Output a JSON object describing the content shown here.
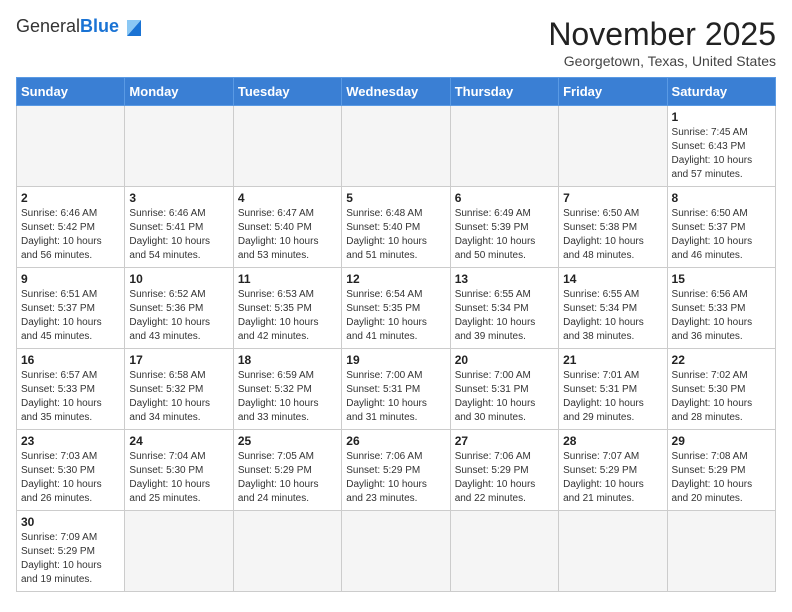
{
  "header": {
    "logo": {
      "line1": "General",
      "line2": "Blue"
    },
    "title": "November 2025",
    "location": "Georgetown, Texas, United States"
  },
  "calendar": {
    "weekdays": [
      "Sunday",
      "Monday",
      "Tuesday",
      "Wednesday",
      "Thursday",
      "Friday",
      "Saturday"
    ],
    "weeks": [
      [
        {
          "day": "",
          "sunrise": "",
          "sunset": "",
          "daylight": ""
        },
        {
          "day": "",
          "sunrise": "",
          "sunset": "",
          "daylight": ""
        },
        {
          "day": "",
          "sunrise": "",
          "sunset": "",
          "daylight": ""
        },
        {
          "day": "",
          "sunrise": "",
          "sunset": "",
          "daylight": ""
        },
        {
          "day": "",
          "sunrise": "",
          "sunset": "",
          "daylight": ""
        },
        {
          "day": "",
          "sunrise": "",
          "sunset": "",
          "daylight": ""
        },
        {
          "day": "1",
          "sunrise": "Sunrise: 7:45 AM",
          "sunset": "Sunset: 6:43 PM",
          "daylight": "Daylight: 10 hours and 57 minutes."
        }
      ],
      [
        {
          "day": "2",
          "sunrise": "Sunrise: 6:46 AM",
          "sunset": "Sunset: 5:42 PM",
          "daylight": "Daylight: 10 hours and 56 minutes."
        },
        {
          "day": "3",
          "sunrise": "Sunrise: 6:46 AM",
          "sunset": "Sunset: 5:41 PM",
          "daylight": "Daylight: 10 hours and 54 minutes."
        },
        {
          "day": "4",
          "sunrise": "Sunrise: 6:47 AM",
          "sunset": "Sunset: 5:40 PM",
          "daylight": "Daylight: 10 hours and 53 minutes."
        },
        {
          "day": "5",
          "sunrise": "Sunrise: 6:48 AM",
          "sunset": "Sunset: 5:40 PM",
          "daylight": "Daylight: 10 hours and 51 minutes."
        },
        {
          "day": "6",
          "sunrise": "Sunrise: 6:49 AM",
          "sunset": "Sunset: 5:39 PM",
          "daylight": "Daylight: 10 hours and 50 minutes."
        },
        {
          "day": "7",
          "sunrise": "Sunrise: 6:50 AM",
          "sunset": "Sunset: 5:38 PM",
          "daylight": "Daylight: 10 hours and 48 minutes."
        },
        {
          "day": "8",
          "sunrise": "Sunrise: 6:50 AM",
          "sunset": "Sunset: 5:37 PM",
          "daylight": "Daylight: 10 hours and 46 minutes."
        }
      ],
      [
        {
          "day": "9",
          "sunrise": "Sunrise: 6:51 AM",
          "sunset": "Sunset: 5:37 PM",
          "daylight": "Daylight: 10 hours and 45 minutes."
        },
        {
          "day": "10",
          "sunrise": "Sunrise: 6:52 AM",
          "sunset": "Sunset: 5:36 PM",
          "daylight": "Daylight: 10 hours and 43 minutes."
        },
        {
          "day": "11",
          "sunrise": "Sunrise: 6:53 AM",
          "sunset": "Sunset: 5:35 PM",
          "daylight": "Daylight: 10 hours and 42 minutes."
        },
        {
          "day": "12",
          "sunrise": "Sunrise: 6:54 AM",
          "sunset": "Sunset: 5:35 PM",
          "daylight": "Daylight: 10 hours and 41 minutes."
        },
        {
          "day": "13",
          "sunrise": "Sunrise: 6:55 AM",
          "sunset": "Sunset: 5:34 PM",
          "daylight": "Daylight: 10 hours and 39 minutes."
        },
        {
          "day": "14",
          "sunrise": "Sunrise: 6:55 AM",
          "sunset": "Sunset: 5:34 PM",
          "daylight": "Daylight: 10 hours and 38 minutes."
        },
        {
          "day": "15",
          "sunrise": "Sunrise: 6:56 AM",
          "sunset": "Sunset: 5:33 PM",
          "daylight": "Daylight: 10 hours and 36 minutes."
        }
      ],
      [
        {
          "day": "16",
          "sunrise": "Sunrise: 6:57 AM",
          "sunset": "Sunset: 5:33 PM",
          "daylight": "Daylight: 10 hours and 35 minutes."
        },
        {
          "day": "17",
          "sunrise": "Sunrise: 6:58 AM",
          "sunset": "Sunset: 5:32 PM",
          "daylight": "Daylight: 10 hours and 34 minutes."
        },
        {
          "day": "18",
          "sunrise": "Sunrise: 6:59 AM",
          "sunset": "Sunset: 5:32 PM",
          "daylight": "Daylight: 10 hours and 33 minutes."
        },
        {
          "day": "19",
          "sunrise": "Sunrise: 7:00 AM",
          "sunset": "Sunset: 5:31 PM",
          "daylight": "Daylight: 10 hours and 31 minutes."
        },
        {
          "day": "20",
          "sunrise": "Sunrise: 7:00 AM",
          "sunset": "Sunset: 5:31 PM",
          "daylight": "Daylight: 10 hours and 30 minutes."
        },
        {
          "day": "21",
          "sunrise": "Sunrise: 7:01 AM",
          "sunset": "Sunset: 5:31 PM",
          "daylight": "Daylight: 10 hours and 29 minutes."
        },
        {
          "day": "22",
          "sunrise": "Sunrise: 7:02 AM",
          "sunset": "Sunset: 5:30 PM",
          "daylight": "Daylight: 10 hours and 28 minutes."
        }
      ],
      [
        {
          "day": "23",
          "sunrise": "Sunrise: 7:03 AM",
          "sunset": "Sunset: 5:30 PM",
          "daylight": "Daylight: 10 hours and 26 minutes."
        },
        {
          "day": "24",
          "sunrise": "Sunrise: 7:04 AM",
          "sunset": "Sunset: 5:30 PM",
          "daylight": "Daylight: 10 hours and 25 minutes."
        },
        {
          "day": "25",
          "sunrise": "Sunrise: 7:05 AM",
          "sunset": "Sunset: 5:29 PM",
          "daylight": "Daylight: 10 hours and 24 minutes."
        },
        {
          "day": "26",
          "sunrise": "Sunrise: 7:06 AM",
          "sunset": "Sunset: 5:29 PM",
          "daylight": "Daylight: 10 hours and 23 minutes."
        },
        {
          "day": "27",
          "sunrise": "Sunrise: 7:06 AM",
          "sunset": "Sunset: 5:29 PM",
          "daylight": "Daylight: 10 hours and 22 minutes."
        },
        {
          "day": "28",
          "sunrise": "Sunrise: 7:07 AM",
          "sunset": "Sunset: 5:29 PM",
          "daylight": "Daylight: 10 hours and 21 minutes."
        },
        {
          "day": "29",
          "sunrise": "Sunrise: 7:08 AM",
          "sunset": "Sunset: 5:29 PM",
          "daylight": "Daylight: 10 hours and 20 minutes."
        }
      ],
      [
        {
          "day": "30",
          "sunrise": "Sunrise: 7:09 AM",
          "sunset": "Sunset: 5:29 PM",
          "daylight": "Daylight: 10 hours and 19 minutes."
        },
        {
          "day": "",
          "sunrise": "",
          "sunset": "",
          "daylight": ""
        },
        {
          "day": "",
          "sunrise": "",
          "sunset": "",
          "daylight": ""
        },
        {
          "day": "",
          "sunrise": "",
          "sunset": "",
          "daylight": ""
        },
        {
          "day": "",
          "sunrise": "",
          "sunset": "",
          "daylight": ""
        },
        {
          "day": "",
          "sunrise": "",
          "sunset": "",
          "daylight": ""
        },
        {
          "day": "",
          "sunrise": "",
          "sunset": "",
          "daylight": ""
        }
      ]
    ]
  }
}
